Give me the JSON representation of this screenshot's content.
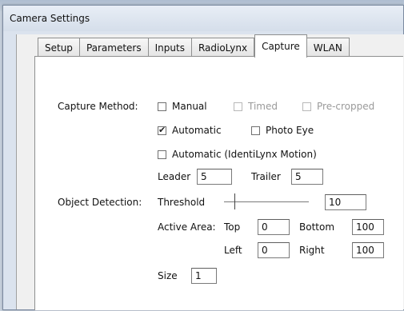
{
  "window": {
    "title": "Camera Settings"
  },
  "tabs": [
    {
      "label": "Setup",
      "active": false
    },
    {
      "label": "Parameters",
      "active": false
    },
    {
      "label": "Inputs",
      "active": false
    },
    {
      "label": "RadioLynx",
      "active": false
    },
    {
      "label": "Capture",
      "active": true
    },
    {
      "label": "WLAN",
      "active": false
    }
  ],
  "capture": {
    "method_label": "Capture Method:",
    "options": {
      "manual": {
        "label": "Manual",
        "checked": false,
        "enabled": true
      },
      "timed": {
        "label": "Timed",
        "checked": false,
        "enabled": false
      },
      "precropped": {
        "label": "Pre-cropped",
        "checked": false,
        "enabled": false
      },
      "automatic": {
        "label": "Automatic",
        "checked": true,
        "enabled": true
      },
      "photo_eye": {
        "label": "Photo Eye",
        "checked": false,
        "enabled": true
      },
      "identilynx": {
        "label": "Automatic (IdentiLynx Motion)",
        "checked": false,
        "enabled": true
      }
    },
    "leader": {
      "label": "Leader",
      "value": "5"
    },
    "trailer": {
      "label": "Trailer",
      "value": "5"
    }
  },
  "object_detection": {
    "label": "Object Detection:",
    "threshold": {
      "label": "Threshold",
      "value": "10",
      "slider_fraction": 0.12
    },
    "active_area": {
      "label": "Active Area:",
      "top": {
        "label": "Top",
        "value": "0"
      },
      "bottom": {
        "label": "Bottom",
        "value": "100"
      },
      "left": {
        "label": "Left",
        "value": "0"
      },
      "right": {
        "label": "Right",
        "value": "100"
      }
    },
    "size": {
      "label": "Size",
      "value": "1"
    }
  }
}
